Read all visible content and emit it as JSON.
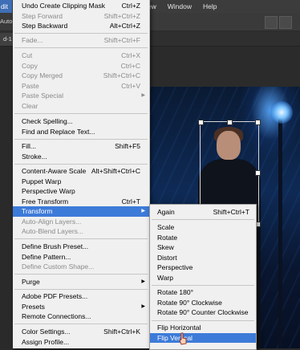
{
  "topbar": {
    "left_menu": "dit",
    "right_menus": [
      "iew",
      "Window",
      "Help"
    ]
  },
  "toolbar": {
    "auto_label": "Auto-"
  },
  "docbar": {
    "tab_label": "d-1 @"
  },
  "edit_menu": {
    "items": [
      {
        "label": "Undo Create Clipping Mask",
        "shortcut": "Ctrl+Z",
        "disabled": false
      },
      {
        "label": "Step Forward",
        "shortcut": "Shift+Ctrl+Z",
        "disabled": true
      },
      {
        "label": "Step Backward",
        "shortcut": "Alt+Ctrl+Z",
        "disabled": false
      },
      {
        "label": "Fade...",
        "shortcut": "Shift+Ctrl+F",
        "disabled": true
      },
      {
        "label": "Cut",
        "shortcut": "Ctrl+X",
        "disabled": true
      },
      {
        "label": "Copy",
        "shortcut": "Ctrl+C",
        "disabled": true
      },
      {
        "label": "Copy Merged",
        "shortcut": "Shift+Ctrl+C",
        "disabled": true
      },
      {
        "label": "Paste",
        "shortcut": "Ctrl+V",
        "disabled": true
      },
      {
        "label": "Paste Special",
        "shortcut": "",
        "disabled": true
      },
      {
        "label": "Clear",
        "shortcut": "",
        "disabled": true
      },
      {
        "label": "Check Spelling...",
        "shortcut": "",
        "disabled": false
      },
      {
        "label": "Find and Replace Text...",
        "shortcut": "",
        "disabled": false
      },
      {
        "label": "Fill...",
        "shortcut": "Shift+F5",
        "disabled": false
      },
      {
        "label": "Stroke...",
        "shortcut": "",
        "disabled": false
      },
      {
        "label": "Content-Aware Scale",
        "shortcut": "Alt+Shift+Ctrl+C",
        "disabled": false
      },
      {
        "label": "Puppet Warp",
        "shortcut": "",
        "disabled": false
      },
      {
        "label": "Perspective Warp",
        "shortcut": "",
        "disabled": false
      },
      {
        "label": "Free Transform",
        "shortcut": "Ctrl+T",
        "disabled": false
      },
      {
        "label": "Transform",
        "shortcut": "",
        "disabled": false
      },
      {
        "label": "Auto-Align Layers...",
        "shortcut": "",
        "disabled": true
      },
      {
        "label": "Auto-Blend Layers...",
        "shortcut": "",
        "disabled": true
      },
      {
        "label": "Define Brush Preset...",
        "shortcut": "",
        "disabled": false
      },
      {
        "label": "Define Pattern...",
        "shortcut": "",
        "disabled": false
      },
      {
        "label": "Define Custom Shape...",
        "shortcut": "",
        "disabled": true
      },
      {
        "label": "Purge",
        "shortcut": "",
        "disabled": false
      },
      {
        "label": "Adobe PDF Presets...",
        "shortcut": "",
        "disabled": false
      },
      {
        "label": "Presets",
        "shortcut": "",
        "disabled": false
      },
      {
        "label": "Remote Connections...",
        "shortcut": "",
        "disabled": false
      },
      {
        "label": "Color Settings...",
        "shortcut": "Shift+Ctrl+K",
        "disabled": false
      },
      {
        "label": "Assign Profile...",
        "shortcut": "",
        "disabled": false
      }
    ]
  },
  "transform_submenu": {
    "items": [
      {
        "label": "Again",
        "shortcut": "Shift+Ctrl+T"
      },
      {
        "label": "Scale",
        "shortcut": ""
      },
      {
        "label": "Rotate",
        "shortcut": ""
      },
      {
        "label": "Skew",
        "shortcut": ""
      },
      {
        "label": "Distort",
        "shortcut": ""
      },
      {
        "label": "Perspective",
        "shortcut": ""
      },
      {
        "label": "Warp",
        "shortcut": ""
      },
      {
        "label": "Rotate 180°",
        "shortcut": ""
      },
      {
        "label": "Rotate 90° Clockwise",
        "shortcut": ""
      },
      {
        "label": "Rotate 90° Counter Clockwise",
        "shortcut": ""
      },
      {
        "label": "Flip Horizontal",
        "shortcut": ""
      },
      {
        "label": "Flip Vertical",
        "shortcut": ""
      }
    ]
  },
  "colors": {
    "highlight": "#3d7bd9",
    "menu_bg": "#f0f0f0",
    "disabled_text": "#8a8a8a"
  }
}
